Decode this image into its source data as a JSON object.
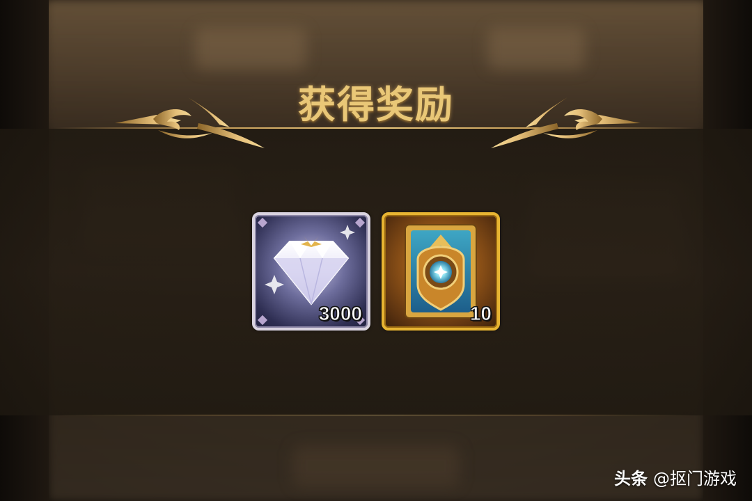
{
  "title": "获得奖励",
  "rewards": [
    {
      "name": "diamond",
      "icon": "diamond-icon",
      "count": "3000",
      "frame_color": "#d9d3e0"
    },
    {
      "name": "summon-card",
      "icon": "card-icon",
      "count": "10",
      "frame_color": "#e7b432"
    }
  ],
  "watermark": {
    "brand": "头条",
    "author": "@抠门游戏"
  },
  "colors": {
    "title_gold": "#e9c777",
    "gold_line": "#d6aa5f",
    "background": "#2a2219"
  }
}
